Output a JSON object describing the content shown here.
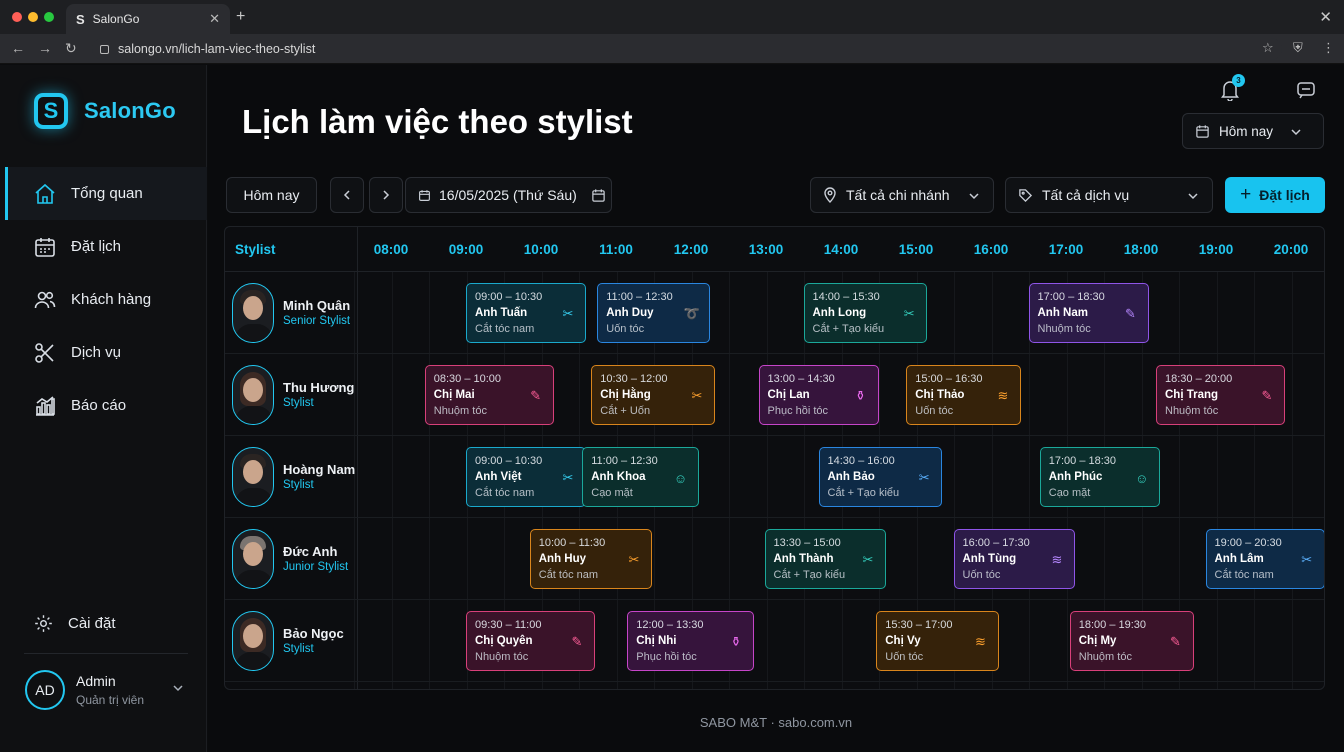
{
  "browser": {
    "tab_title": "SalonGo",
    "tab_logo": "S",
    "url": "salongo.vn/lich-lam-viec-theo-stylist"
  },
  "sidebar": {
    "brand": "SalonGo",
    "brand_mark": "S",
    "items": [
      {
        "label": "Tổng quan",
        "icon": "home-icon",
        "active": true
      },
      {
        "label": "Đặt lịch",
        "icon": "calendar-icon",
        "active": false
      },
      {
        "label": "Khách hàng",
        "icon": "users-icon",
        "active": false
      },
      {
        "label": "Dịch vụ",
        "icon": "scissors-icon",
        "active": false
      },
      {
        "label": "Báo cáo",
        "icon": "chart-icon",
        "active": false
      }
    ],
    "settings_label": "Cài đặt",
    "user": {
      "initials": "AD",
      "name": "Admin",
      "role": "Quản trị viên"
    }
  },
  "header": {
    "title": "Lịch làm việc theo stylist",
    "notification_count": "3",
    "period": "Hôm nay"
  },
  "toolbar": {
    "today": "Hôm nay",
    "date": "16/05/2025 (Thứ Sáu)",
    "branch": "Tất cả chi nhánh",
    "service": "Tất cả dịch vụ",
    "book": "Đặt lịch"
  },
  "schedule": {
    "stylist_header": "Stylist",
    "hours": [
      "08:00",
      "09:00",
      "10:00",
      "11:00",
      "12:00",
      "13:00",
      "14:00",
      "15:00",
      "16:00",
      "17:00",
      "18:00",
      "19:00",
      "20:00"
    ],
    "stylists": [
      {
        "name": "Minh Quân",
        "role": "Senior Stylist",
        "hair": "short",
        "appointments": [
          {
            "time": "09:00 – 10:30",
            "start": 9.0,
            "end": 10.6,
            "customer": "Anh Tuấn",
            "service": "Cắt tóc nam",
            "color": "teal",
            "icon": "scissors-icon"
          },
          {
            "time": "11:00 – 12:30",
            "start": 10.75,
            "end": 12.25,
            "customer": "Anh Duy",
            "service": "Uốn tóc",
            "color": "blue",
            "icon": "curl-icon"
          },
          {
            "time": "14:00 – 15:30",
            "start": 13.5,
            "end": 15.15,
            "customer": "Anh Long",
            "service": "Cắt + Tạo kiểu",
            "color": "green",
            "icon": "scissors-icon"
          },
          {
            "time": "17:00 – 18:30",
            "start": 16.5,
            "end": 18.1,
            "customer": "Anh Nam",
            "service": "Nhuộm tóc",
            "color": "purple",
            "icon": "dye-brush-icon"
          }
        ]
      },
      {
        "name": "Thu Hương",
        "role": "Stylist",
        "hair": "long",
        "appointments": [
          {
            "time": "08:30 – 10:00",
            "start": 8.45,
            "end": 10.17,
            "customer": "Chị Mai",
            "service": "Nhuộm tóc",
            "color": "pink",
            "icon": "dye-brush-icon"
          },
          {
            "time": "10:30 – 12:00",
            "start": 10.67,
            "end": 12.32,
            "customer": "Chị Hằng",
            "service": "Cắt + Uốn",
            "color": "orange",
            "icon": "scissors-icon"
          },
          {
            "time": "13:00 – 14:30",
            "start": 12.9,
            "end": 14.5,
            "customer": "Chị Lan",
            "service": "Phục hồi tóc",
            "color": "magenta",
            "icon": "bottle-icon"
          },
          {
            "time": "15:00 – 16:30",
            "start": 14.87,
            "end": 16.4,
            "customer": "Chị Thảo",
            "service": "Uốn tóc",
            "color": "orange",
            "icon": "wave-icon"
          },
          {
            "time": "18:30 – 20:00",
            "start": 18.2,
            "end": 19.92,
            "customer": "Chị Trang",
            "service": "Nhuộm tóc",
            "color": "pink",
            "icon": "dye-brush-icon"
          }
        ]
      },
      {
        "name": "Hoàng Nam",
        "role": "Stylist",
        "hair": "short",
        "appointments": [
          {
            "time": "09:00 – 10:30",
            "start": 9.0,
            "end": 10.6,
            "customer": "Anh Việt",
            "service": "Cắt tóc nam",
            "color": "teal",
            "icon": "scissors-icon"
          },
          {
            "time": "11:00 – 12:30",
            "start": 10.55,
            "end": 12.1,
            "customer": "Anh Khoa",
            "service": "Cạo mặt",
            "color": "green",
            "icon": "face-shave-icon"
          },
          {
            "time": "14:30 – 16:00",
            "start": 13.7,
            "end": 15.35,
            "customer": "Anh Bảo",
            "service": "Cắt + Tạo kiểu",
            "color": "blue",
            "icon": "scissors-icon"
          },
          {
            "time": "17:00 – 18:30",
            "start": 16.65,
            "end": 18.25,
            "customer": "Anh Phúc",
            "service": "Cạo mặt",
            "color": "green",
            "icon": "face-shave-icon"
          }
        ]
      },
      {
        "name": "Đức Anh",
        "role": "Junior Stylist",
        "hair": "light",
        "appointments": [
          {
            "time": "10:00 – 11:30",
            "start": 9.85,
            "end": 11.48,
            "customer": "Anh Huy",
            "service": "Cắt tóc nam",
            "color": "orange",
            "icon": "scissors-icon"
          },
          {
            "time": "13:30 – 15:00",
            "start": 12.98,
            "end": 14.6,
            "customer": "Anh Thành",
            "service": "Cắt + Tạo kiểu",
            "color": "green",
            "icon": "scissors-icon"
          },
          {
            "time": "16:00 – 17:30",
            "start": 15.5,
            "end": 17.12,
            "customer": "Anh Tùng",
            "service": "Uốn tóc",
            "color": "purple",
            "icon": "wave-icon"
          },
          {
            "time": "19:00 – 20:30",
            "start": 18.86,
            "end": 20.45,
            "customer": "Anh Lâm",
            "service": "Cắt tóc nam",
            "color": "blue",
            "icon": "scissors-icon"
          }
        ]
      },
      {
        "name": "Bảo Ngọc",
        "role": "Stylist",
        "hair": "long",
        "appointments": [
          {
            "time": "09:30 – 11:00",
            "start": 9.0,
            "end": 10.72,
            "customer": "Chị Quyên",
            "service": "Nhuộm tóc",
            "color": "pink",
            "icon": "dye-brush-icon"
          },
          {
            "time": "12:00 – 13:30",
            "start": 11.15,
            "end": 12.84,
            "customer": "Chị Nhi",
            "service": "Phục hồi tóc",
            "color": "magenta",
            "icon": "bottle-icon"
          },
          {
            "time": "15:30 – 17:00",
            "start": 14.47,
            "end": 16.1,
            "customer": "Chị Vy",
            "service": "Uốn tóc",
            "color": "orange",
            "icon": "wave-icon"
          },
          {
            "time": "18:00 – 19:30",
            "start": 17.05,
            "end": 18.7,
            "customer": "Chị My",
            "service": "Nhuộm tóc",
            "color": "pink",
            "icon": "dye-brush-icon"
          }
        ]
      }
    ]
  },
  "footer": "SABO M&T · sabo.com.vn"
}
